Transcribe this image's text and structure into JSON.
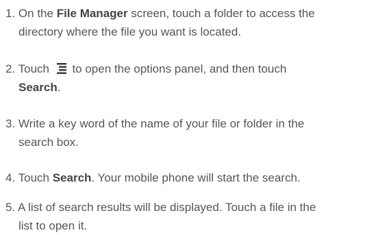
{
  "steps": [
    {
      "num": "1.",
      "a": "On the ",
      "bold": "File Manager",
      "b": " screen, touch a folder to access the",
      "cont": "directory where the file you want is located."
    },
    {
      "num": "2.",
      "a": "Touch",
      "icon": "menu-options-icon",
      "b": "to open the options panel, and then touch",
      "cont_bold": "Search",
      "cont_tail": "."
    },
    {
      "num": "3.",
      "a": "Write a key word of the name of your file or folder in the",
      "cont": "search box."
    },
    {
      "num": "4.",
      "a": "Touch ",
      "bold": "Search",
      "b": ". Your mobile phone will start the search."
    },
    {
      "num": "5.",
      "a": "A list of search results will be displayed. Touch a file in the",
      "cont": "list to open it."
    }
  ],
  "colors": {
    "text": "#555555",
    "bold_text": "#444444",
    "icon": "#333333"
  }
}
